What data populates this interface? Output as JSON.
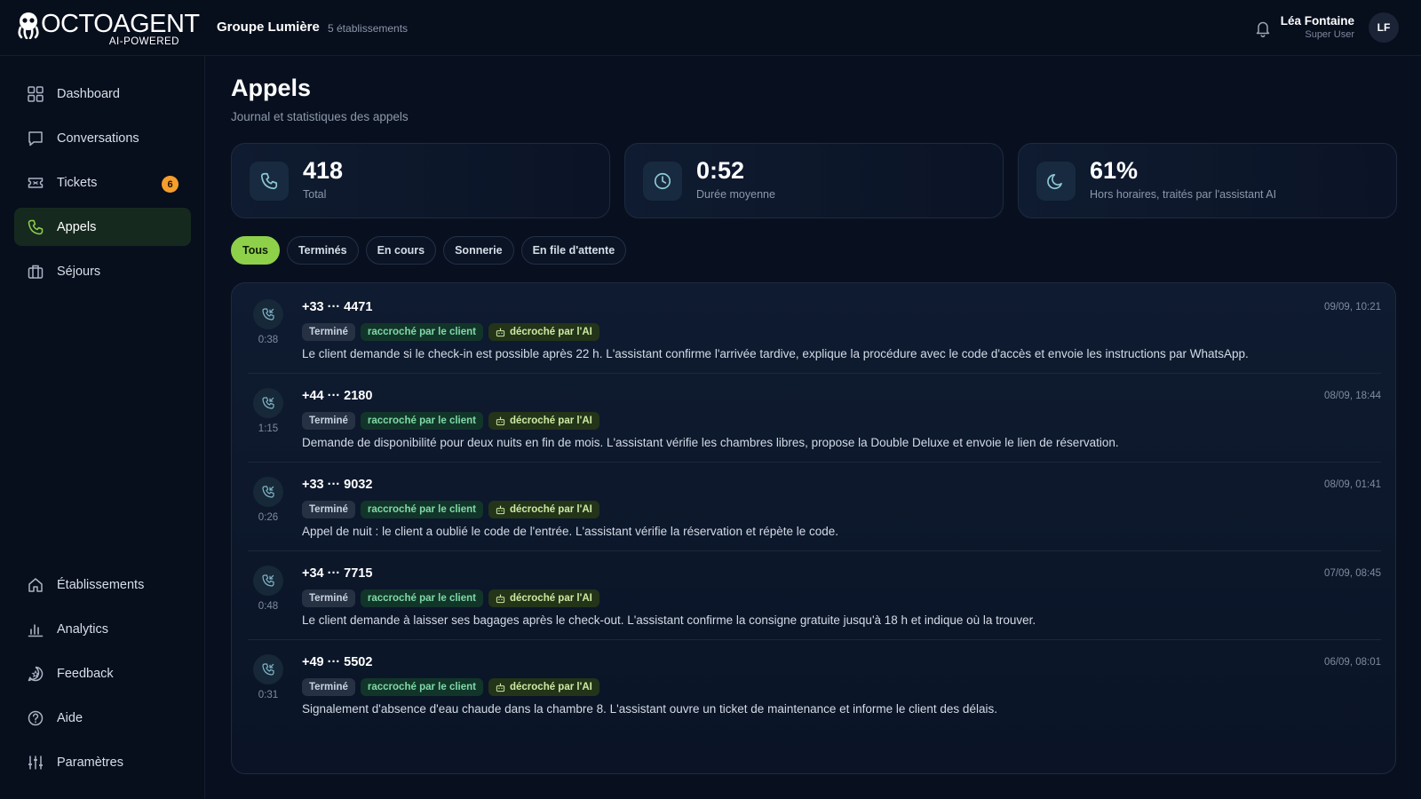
{
  "app": {
    "logo_text": "OCTOAGENT",
    "logo_subtitle": "AI-POWERED"
  },
  "header": {
    "org_name": "Groupe Lumière",
    "org_count": "5 établissements",
    "user_name": "Léa Fontaine",
    "user_role": "Super User",
    "avatar_initials": "LF"
  },
  "sidebar": {
    "top_items": [
      {
        "label": "Dashboard",
        "icon": "grid-icon"
      },
      {
        "label": "Conversations",
        "icon": "chat-icon"
      },
      {
        "label": "Tickets",
        "icon": "ticket-icon",
        "badge": "6"
      },
      {
        "label": "Appels",
        "icon": "phone-icon",
        "active": true
      },
      {
        "label": "Séjours",
        "icon": "suitcase-icon"
      }
    ],
    "bottom_items": [
      {
        "label": "Établissements",
        "icon": "home-icon"
      },
      {
        "label": "Analytics",
        "icon": "bar-chart-icon"
      },
      {
        "label": "Feedback",
        "icon": "feedback-icon"
      },
      {
        "label": "Aide",
        "icon": "help-icon"
      },
      {
        "label": "Paramètres",
        "icon": "sliders-icon"
      }
    ]
  },
  "page": {
    "title": "Appels",
    "subtitle": "Journal et statistiques des appels"
  },
  "stats": [
    {
      "value": "418",
      "label": "Total",
      "icon": "phone-icon"
    },
    {
      "value": "0:52",
      "label": "Durée moyenne",
      "icon": "clock-icon"
    },
    {
      "value": "61%",
      "label": "Hors horaires, traités par l'assistant AI",
      "icon": "moon-icon"
    }
  ],
  "filters": [
    {
      "label": "Tous",
      "active": true
    },
    {
      "label": "Terminés"
    },
    {
      "label": "En cours"
    },
    {
      "label": "Sonnerie"
    },
    {
      "label": "En file d'attente"
    }
  ],
  "calls": [
    {
      "number": "+33 ··· 4471",
      "duration": "0:38",
      "date": "09/09, 10:21",
      "status": "Terminé",
      "hangup": "raccroché par le client",
      "ai": "décroché par l'AI",
      "summary": "Le client demande si le check-in est possible après 22 h. L'assistant confirme l'arrivée tardive, explique la procédure avec le code d'accès et envoie les instructions par WhatsApp."
    },
    {
      "number": "+44 ··· 2180",
      "duration": "1:15",
      "date": "08/09, 18:44",
      "status": "Terminé",
      "hangup": "raccroché par le client",
      "ai": "décroché par l'AI",
      "summary": "Demande de disponibilité pour deux nuits en fin de mois. L'assistant vérifie les chambres libres, propose la Double Deluxe et envoie le lien de réservation."
    },
    {
      "number": "+33 ··· 9032",
      "duration": "0:26",
      "date": "08/09, 01:41",
      "status": "Terminé",
      "hangup": "raccroché par le client",
      "ai": "décroché par l'AI",
      "summary": "Appel de nuit : le client a oublié le code de l'entrée. L'assistant vérifie la réservation et répète le code."
    },
    {
      "number": "+34 ··· 7715",
      "duration": "0:48",
      "date": "07/09, 08:45",
      "status": "Terminé",
      "hangup": "raccroché par le client",
      "ai": "décroché par l'AI",
      "summary": "Le client demande à laisser ses bagages après le check-out. L'assistant confirme la consigne gratuite jusqu'à 18 h et indique où la trouver."
    },
    {
      "number": "+49 ··· 5502",
      "duration": "0:31",
      "date": "06/09, 08:01",
      "status": "Terminé",
      "hangup": "raccroché par le client",
      "ai": "décroché par l'AI",
      "summary": "Signalement d'absence d'eau chaude dans la chambre 8. L'assistant ouvre un ticket de maintenance et informe le client des délais."
    }
  ],
  "colors": {
    "accent": "#8fd04a",
    "badge": "#f59e2c",
    "background": "#08101f"
  }
}
